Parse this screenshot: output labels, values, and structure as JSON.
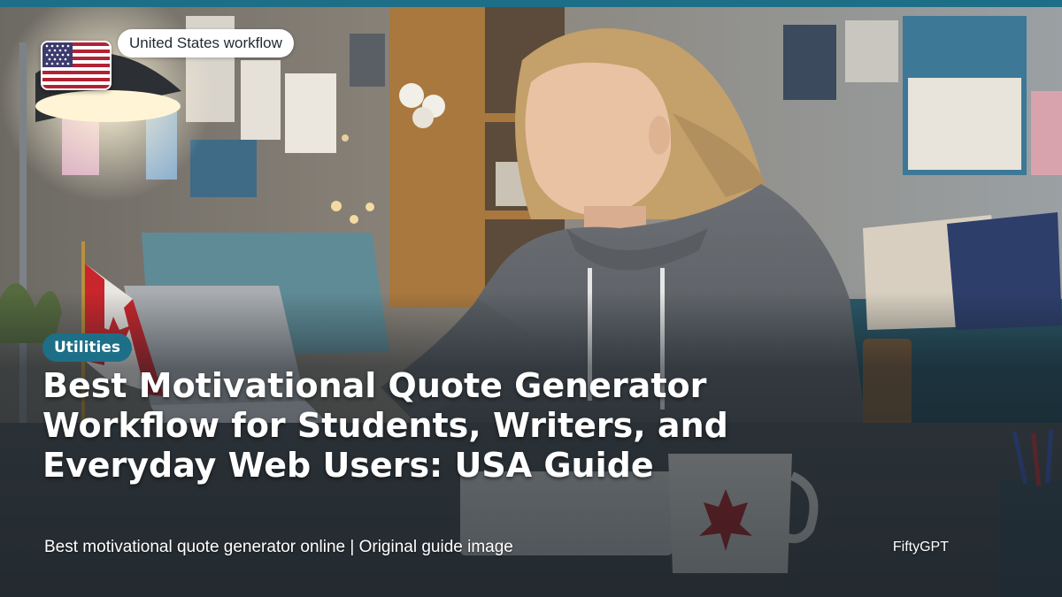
{
  "region_badge": {
    "label": "United States workflow",
    "flag_icon": "us-flag-icon"
  },
  "category": {
    "label": "Utilities"
  },
  "headline": {
    "title": "Best Motivational Quote Generator Workflow for Students, Writers, and Everyday Web Users: USA Guide"
  },
  "footer": {
    "caption": "Best motivational quote generator online | Original guide image",
    "brand": "FiftyGPT"
  },
  "colors": {
    "accent": "#1d6f87",
    "text_light": "#ffffff",
    "pill_bg": "#ffffff"
  }
}
